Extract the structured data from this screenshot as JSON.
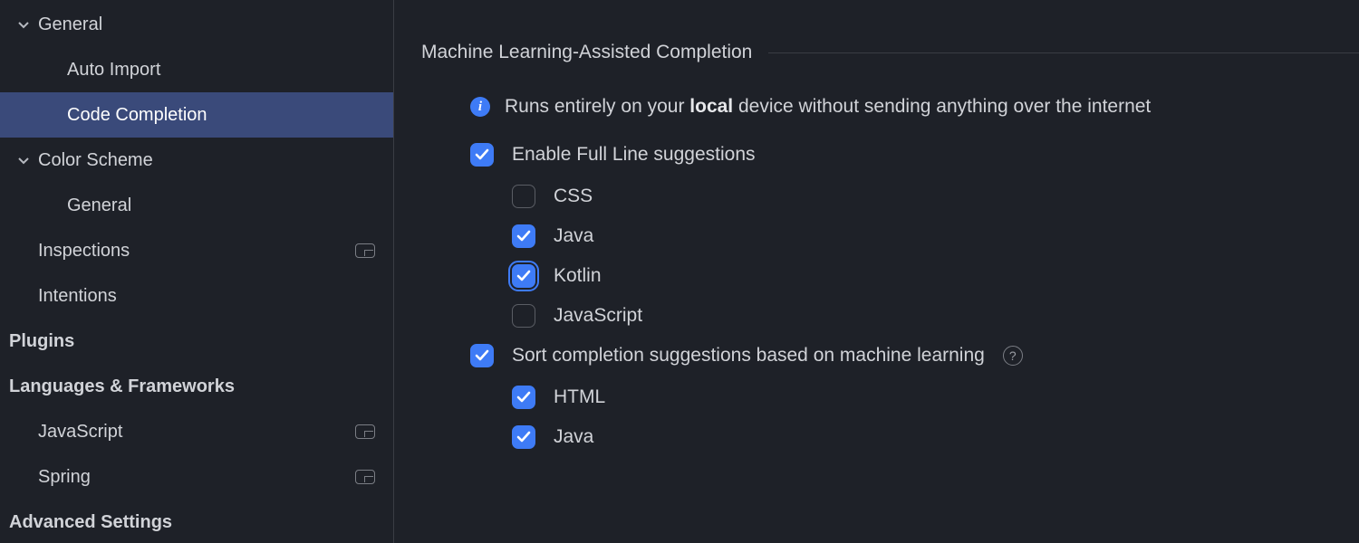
{
  "sidebar": {
    "items": [
      {
        "label": "General",
        "depth": 0,
        "expandable": true,
        "expanded": true,
        "bold": false,
        "selected": false,
        "badge": false
      },
      {
        "label": "Auto Import",
        "depth": 2,
        "expandable": false,
        "expanded": false,
        "bold": false,
        "selected": false,
        "badge": false
      },
      {
        "label": "Code Completion",
        "depth": 2,
        "expandable": false,
        "expanded": false,
        "bold": false,
        "selected": true,
        "badge": false
      },
      {
        "label": "Color Scheme",
        "depth": 0,
        "expandable": true,
        "expanded": true,
        "bold": false,
        "selected": false,
        "badge": false
      },
      {
        "label": "General",
        "depth": 2,
        "expandable": false,
        "expanded": false,
        "bold": false,
        "selected": false,
        "badge": false
      },
      {
        "label": "Inspections",
        "depth": 1,
        "expandable": false,
        "expanded": false,
        "bold": false,
        "selected": false,
        "badge": true
      },
      {
        "label": "Intentions",
        "depth": 1,
        "expandable": false,
        "expanded": false,
        "bold": false,
        "selected": false,
        "badge": false
      },
      {
        "label": "Plugins",
        "depth": 0,
        "expandable": false,
        "expanded": false,
        "bold": true,
        "selected": false,
        "badge": false
      },
      {
        "label": "Languages & Frameworks",
        "depth": 0,
        "expandable": false,
        "expanded": false,
        "bold": true,
        "selected": false,
        "badge": false
      },
      {
        "label": "JavaScript",
        "depth": 1,
        "expandable": false,
        "expanded": false,
        "bold": false,
        "selected": false,
        "badge": true
      },
      {
        "label": "Spring",
        "depth": 1,
        "expandable": false,
        "expanded": false,
        "bold": false,
        "selected": false,
        "badge": true
      },
      {
        "label": "Advanced Settings",
        "depth": 0,
        "expandable": false,
        "expanded": false,
        "bold": true,
        "selected": false,
        "badge": false
      }
    ]
  },
  "panel": {
    "section_title": "Machine Learning-Assisted Completion",
    "info_prefix": "Runs entirely on your ",
    "info_bold": "local",
    "info_suffix": " device without sending anything over the internet",
    "enable_fullline": {
      "label": "Enable Full Line suggestions",
      "checked": true
    },
    "fullline_langs": [
      {
        "label": "CSS",
        "checked": false,
        "focused": false
      },
      {
        "label": "Java",
        "checked": true,
        "focused": false
      },
      {
        "label": "Kotlin",
        "checked": true,
        "focused": true
      },
      {
        "label": "JavaScript",
        "checked": false,
        "focused": false
      }
    ],
    "sort_ml": {
      "label": "Sort completion suggestions based on machine learning",
      "checked": true,
      "help": true
    },
    "sort_langs": [
      {
        "label": "HTML",
        "checked": true
      },
      {
        "label": "Java",
        "checked": true
      }
    ]
  }
}
